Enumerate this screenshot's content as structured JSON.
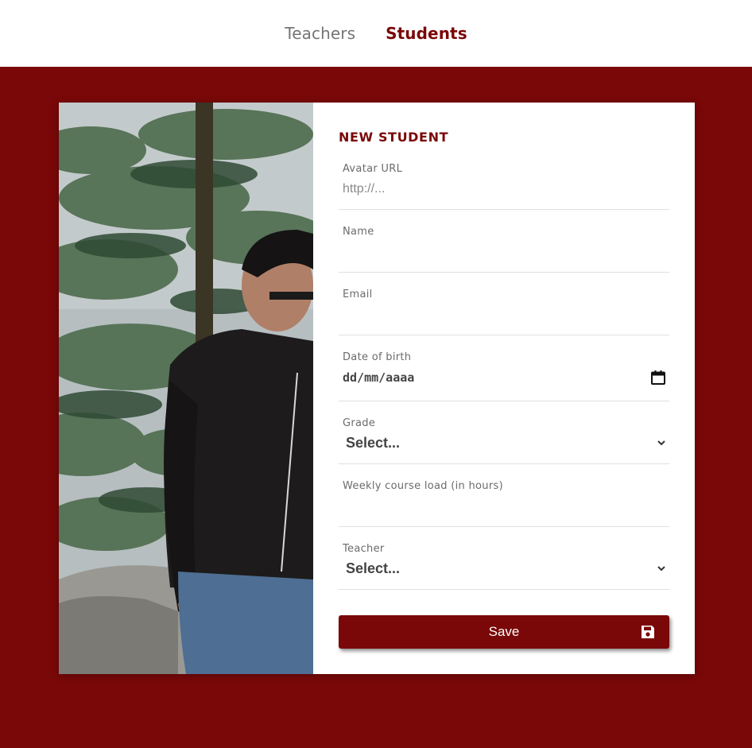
{
  "nav": {
    "items": [
      {
        "label": "Teachers",
        "active": false
      },
      {
        "label": "Students",
        "active": true
      }
    ]
  },
  "colors": {
    "brand": "#7a0808",
    "muted_text": "#757575",
    "divider": "#e0e0e0"
  },
  "form": {
    "title": "NEW STUDENT",
    "avatar": {
      "label": "Avatar URL",
      "value": "",
      "placeholder": "http://..."
    },
    "name": {
      "label": "Name",
      "value": ""
    },
    "email": {
      "label": "Email",
      "value": ""
    },
    "dob": {
      "label": "Date of birth",
      "value": "dd/mm/aaaa",
      "icon": "calendar-icon"
    },
    "grade": {
      "label": "Grade",
      "selected": "Select...",
      "icon": "chevron-down-icon"
    },
    "weekly_load": {
      "label": "Weekly course load (in hours)",
      "value": ""
    },
    "teacher": {
      "label": "Teacher",
      "selected": "Select...",
      "icon": "chevron-down-icon"
    },
    "save": {
      "label": "Save",
      "icon": "floppy-disk-icon"
    }
  }
}
